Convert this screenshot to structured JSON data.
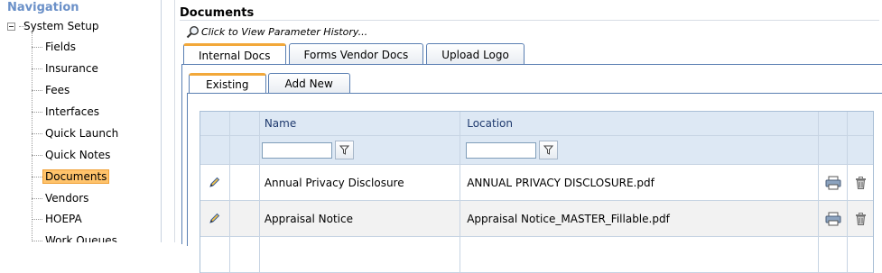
{
  "nav": {
    "title": "Navigation",
    "root": "System Setup",
    "items": [
      {
        "label": "Fields"
      },
      {
        "label": "Insurance"
      },
      {
        "label": "Fees"
      },
      {
        "label": "Interfaces"
      },
      {
        "label": "Quick Launch"
      },
      {
        "label": "Quick Notes"
      },
      {
        "label": "Documents",
        "selected": true
      },
      {
        "label": "Vendors"
      },
      {
        "label": "HOEPA"
      },
      {
        "label": "Work Queues"
      }
    ]
  },
  "main": {
    "title": "Documents",
    "history_link": "Click to View Parameter History...",
    "tabs": [
      "Internal Docs",
      "Forms Vendor Docs",
      "Upload Logo"
    ],
    "subtabs": [
      "Existing",
      "Add New"
    ]
  },
  "grid": {
    "columns": [
      "Name",
      "Location"
    ],
    "filter_name": "",
    "filter_location": "",
    "rows": [
      {
        "name": "Annual Privacy Disclosure",
        "location": "ANNUAL PRIVACY DISCLOSURE.pdf"
      },
      {
        "name": "Appraisal Notice",
        "location": "Appraisal Notice_MASTER_Fillable.pdf"
      }
    ]
  },
  "colors": {
    "accent": "#f2a83a",
    "border": "#5a7fb2",
    "header_bg": "#dde8f4",
    "nav_title": "#6a90c8"
  },
  "icons": [
    "magnifier-icon",
    "filter-icon",
    "edit-pencil-icon",
    "printer-icon",
    "trash-icon"
  ]
}
